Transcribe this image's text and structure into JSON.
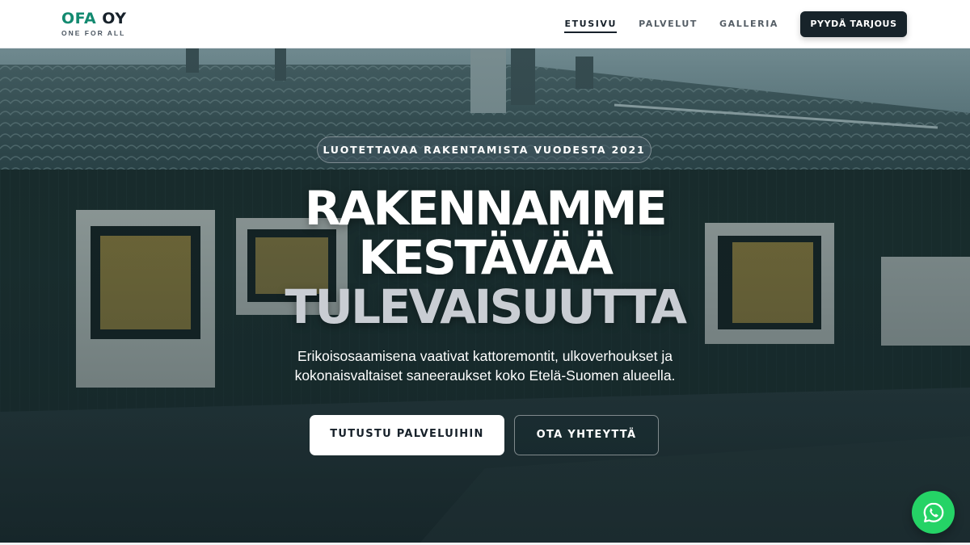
{
  "header": {
    "logo": {
      "accent": "OFA",
      "rest": " OY",
      "tagline": "ONE FOR ALL"
    },
    "nav": [
      {
        "label": "ETUSIVU",
        "active": true
      },
      {
        "label": "PALVELUT",
        "active": false
      },
      {
        "label": "GALLERIA",
        "active": false
      }
    ],
    "cta_label": "PYYDÄ TARJOUS"
  },
  "hero": {
    "badge": "LUOTETTAVAA RAKENTAMISTA VUODESTA 2021",
    "headline": [
      "RAKENNAMME",
      "KESTÄVÄÄ",
      "TULEVAISUUTTA"
    ],
    "lead_line1": "Erikoisosaamisena vaativat kattoremontit, ulkoverhoukset ja",
    "lead_line2": "kokonaisvaltaiset saneeraukset koko Etelä-Suomen alueella.",
    "primary_button": "TUTUSTU PALVELUIHIN",
    "secondary_button": "OTA YHTEYTTÄ",
    "background_image": "house-roof-photo"
  },
  "floating": {
    "whatsapp_icon": "whatsapp-icon"
  },
  "colors": {
    "brand_green": "#138a70",
    "dark": "#17232a",
    "whatsapp": "#25d366"
  }
}
